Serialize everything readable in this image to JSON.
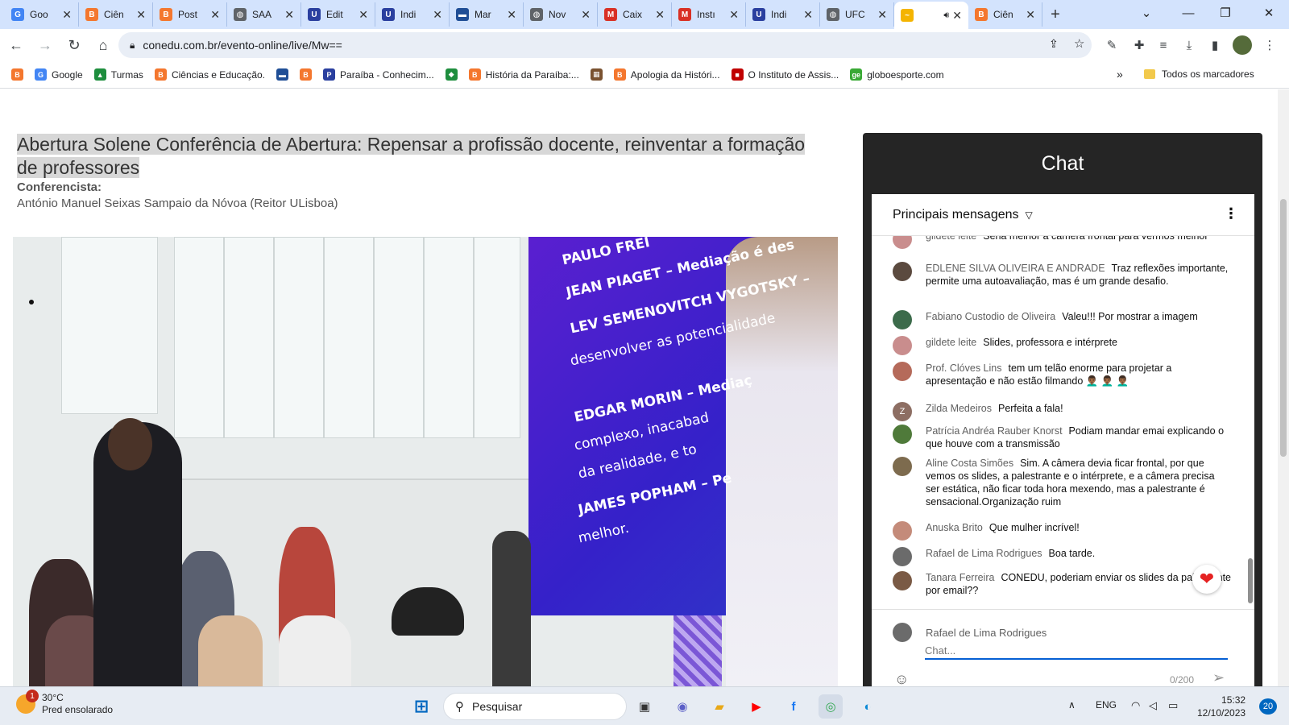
{
  "browser": {
    "tabs": [
      {
        "title": "Goo",
        "icon": "google-icon",
        "color": "#4285f4",
        "glyph": "G"
      },
      {
        "title": "Ciên",
        "icon": "blogger-icon",
        "color": "#f4772e",
        "glyph": "B"
      },
      {
        "title": "Post",
        "icon": "blogger-icon",
        "color": "#f4772e",
        "glyph": "B"
      },
      {
        "title": "SAA",
        "icon": "globe-icon",
        "color": "#5f6368",
        "glyph": "◍"
      },
      {
        "title": "Edit",
        "icon": "shield-icon",
        "color": "#2a3f9f",
        "glyph": "U"
      },
      {
        "title": "Indi",
        "icon": "shield-icon",
        "color": "#2a3f9f",
        "glyph": "U"
      },
      {
        "title": "Mar",
        "icon": "flag-icon",
        "color": "#1f4e96",
        "glyph": "▬"
      },
      {
        "title": "Nov",
        "icon": "globe-icon",
        "color": "#5f6368",
        "glyph": "◍"
      },
      {
        "title": "Caix",
        "icon": "gmail-icon",
        "color": "#d93025",
        "glyph": "M"
      },
      {
        "title": "Instı",
        "icon": "gmail-icon",
        "color": "#d93025",
        "glyph": "M"
      },
      {
        "title": "Indi",
        "icon": "shield-icon",
        "color": "#2a3f9f",
        "glyph": "U"
      },
      {
        "title": "UFC",
        "icon": "globe-icon",
        "color": "#5f6368",
        "glyph": "◍"
      },
      {
        "title": "",
        "icon": "conedu-icon",
        "color": "#f4b400",
        "glyph": "~",
        "active": true
      },
      {
        "title": "Ciên",
        "icon": "blogger-icon",
        "color": "#f4772e",
        "glyph": "B"
      }
    ],
    "url": "conedu.com.br/evento-online/live/Mw==",
    "bookmarks": [
      {
        "label": "",
        "icon": "blogger-icon",
        "color": "#f4772e",
        "glyph": "B"
      },
      {
        "label": "Google",
        "icon": "google-icon",
        "color": "#4285f4",
        "glyph": "G"
      },
      {
        "label": "Turmas",
        "icon": "classroom-icon",
        "color": "#1e8e3e",
        "glyph": "▲"
      },
      {
        "label": "Ciências e Educação.",
        "icon": "blogger-icon",
        "color": "#f4772e",
        "glyph": "B"
      },
      {
        "label": "",
        "icon": "flag-icon",
        "color": "#1f4e96",
        "glyph": "▬"
      },
      {
        "label": "",
        "icon": "blogger-icon",
        "color": "#f4772e",
        "glyph": "B"
      },
      {
        "label": "Paraíba - Conhecim...",
        "icon": "site-icon",
        "color": "#2a3f9f",
        "glyph": "P"
      },
      {
        "label": "",
        "icon": "brazil-flag-icon",
        "color": "#1e8e3e",
        "glyph": "◆"
      },
      {
        "label": "História da Paraíba:...",
        "icon": "blogger-icon",
        "color": "#f4772e",
        "glyph": "B"
      },
      {
        "label": "",
        "icon": "image-icon",
        "color": "#7a5230",
        "glyph": "▦"
      },
      {
        "label": "Apologia da Históri...",
        "icon": "blogger-icon",
        "color": "#f4772e",
        "glyph": "B"
      },
      {
        "label": "O Instituto de Assis...",
        "icon": "flag-icon",
        "color": "#c00000",
        "glyph": "■"
      },
      {
        "label": "globoesporte.com",
        "icon": "ge-icon",
        "color": "#39a935",
        "glyph": "ge"
      }
    ],
    "bookmarks_more": "»",
    "all_bookmarks": "Todos os marcadores"
  },
  "event": {
    "title": "Abertura Solene Conferência de Abertura: Repensar a profissão docente, reinventar a formação de professores",
    "speaker_label": "Conferencista:",
    "speaker_name": "António Manuel Seixas Sampaio da Nóvoa (Reitor ULisboa)"
  },
  "video": {
    "slide_lines": [
      "PAULO FREI",
      "JEAN PIAGET – Mediação é des",
      "LEV SEMENOVITCH VYGOTSKY –",
      "desenvolver as potencialidade",
      "EDGAR MORIN – Mediaç",
      "complexo, inacabad",
      "da realidade, e to",
      "JAMES POPHAM – Pe",
      "melhor."
    ]
  },
  "chat": {
    "title": "Chat",
    "filter_label": "Principais mensagens",
    "messages": [
      {
        "author": "gildete leite",
        "text": "Seria melhor a câmera frontal para vermos melhor",
        "avatar_color": "#c98d8d",
        "initial": ""
      },
      {
        "author": "EDLENE SILVA OLIVEIRA E ANDRADE",
        "text": "Traz reflexões importante, permite uma autoavaliação, mas é um grande desafio.",
        "avatar_color": "#5b4a3f",
        "initial": ""
      },
      {
        "author": "Fabiano Custodio de Oliveira",
        "text": "Valeu!!! Por mostrar a imagem",
        "avatar_color": "#3c6b4b",
        "initial": ""
      },
      {
        "author": "gildete leite",
        "text": "Slides, professora e intérprete",
        "avatar_color": "#c98d8d",
        "initial": ""
      },
      {
        "author": "Prof. Clóves Lins",
        "text": "tem um telão enorme para projetar a apresentação e não estão filmando 👨🏾‍🦱 👨🏾‍🦱 👨🏾‍🦱",
        "avatar_color": "#b56a5a",
        "initial": ""
      },
      {
        "author": "Zilda Medeiros",
        "text": "Perfeita a fala!",
        "avatar_color": "#8d6e63",
        "initial": "Z"
      },
      {
        "author": "Patrícia Andréa Rauber Knorst",
        "text": "Podiam mandar emai explicando o que houve com a transmissão",
        "avatar_color": "#4f7a3a",
        "initial": ""
      },
      {
        "author": "Aline Costa Simões",
        "text": "Sim. A câmera devia ficar frontal, por que vemos os slides, a palestrante e o intérprete, e a câmera precisa ser estática, não ficar toda hora mexendo, mas a palestrante é sensacional.Organização ruim",
        "avatar_color": "#7d6b4e",
        "initial": ""
      },
      {
        "author": "Anuska Brito",
        "text": "Que mulher incrível!",
        "avatar_color": "#c48b7a",
        "initial": ""
      },
      {
        "author": "Rafael de Lima Rodrigues",
        "text": "Boa tarde.",
        "avatar_color": "#6b6b6b",
        "initial": ""
      },
      {
        "author": "Tanara Ferreira",
        "text": "CONEDU, poderiam enviar os slides da palestrante por email??",
        "avatar_color": "#7a5a45",
        "initial": ""
      }
    ],
    "current_user": "Rafael de Lima Rodrigues",
    "input_placeholder": "Chat...",
    "char_count": "0/200"
  },
  "taskbar": {
    "weather_temp": "30°C",
    "weather_desc": "Pred ensolarado",
    "weather_badge": "1",
    "search_label": "Pesquisar",
    "language": "ENG",
    "time": "15:32",
    "date": "12/10/2023",
    "notification_count": "20"
  }
}
